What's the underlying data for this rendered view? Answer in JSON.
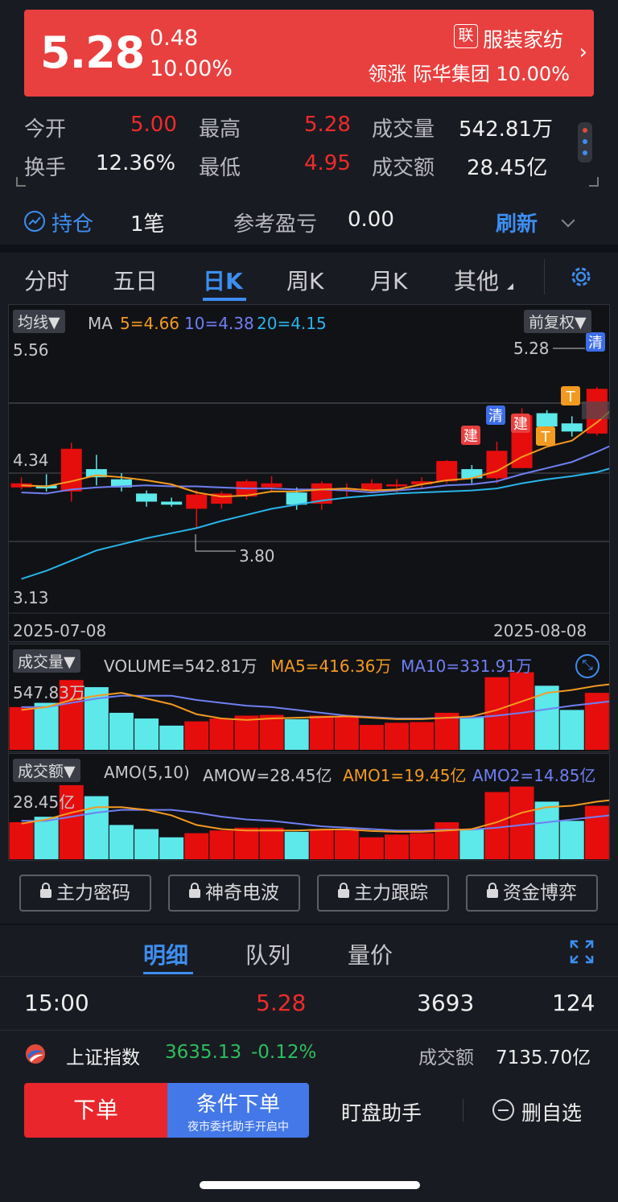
{
  "header": {
    "price": "5.28",
    "change": "0.48",
    "change_pct": "10.00%",
    "sector_tag": "联",
    "sector_name": "服装家纺",
    "leader_label": "领涨",
    "leader_name": "际华集团",
    "leader_pct": "10.00%",
    "colors": {
      "up": "#e8403f"
    }
  },
  "stats": [
    {
      "label": "今开",
      "value": "5.00"
    },
    {
      "label": "最高",
      "value": "5.28"
    },
    {
      "label": "成交量",
      "value": "542.81万"
    },
    {
      "label": "换手",
      "value": "12.36%"
    },
    {
      "label": "最低",
      "value": "4.95"
    },
    {
      "label": "成交额",
      "value": "28.45亿"
    }
  ],
  "position": {
    "label": "持仓",
    "count": "1笔",
    "pl_label": "参考盈亏",
    "pl_value": "0.00",
    "refresh": "刷新"
  },
  "tabs": [
    "分时",
    "五日",
    "日K",
    "周K",
    "月K",
    "其他"
  ],
  "active_tab": "日K",
  "kchart": {
    "ma_dropdown": "均线▼",
    "ma_label": "MA",
    "ma5": "5=4.66",
    "ma10": "10=4.38",
    "ma20": "20=4.15",
    "adjust": "前复权▼",
    "y_top": "5.56",
    "y_mid": "4.34",
    "y_bot": "3.13",
    "high_mark": "5.28",
    "low_mark": "3.80",
    "date_start": "2025-07-08",
    "date_end": "2025-08-08",
    "markers": [
      "建",
      "清",
      "建",
      "T",
      "T",
      "清"
    ]
  },
  "volume": {
    "dropdown": "成交量▼",
    "volume_label": "VOLUME=542.81万",
    "ma5_label": "MA5=416.36万",
    "ma10_label": "MA10=331.91万",
    "max_label": "547.83万"
  },
  "amount": {
    "dropdown": "成交额▼",
    "amo_label": "AMO(5,10)",
    "amow_label": "AMOW=28.45亿",
    "amo1_label": "AMO1=19.45亿",
    "amo2_label": "AMO2=14.85亿",
    "max_label": "28.45亿"
  },
  "chart_data": {
    "type": "candlestick",
    "x_start": "2025-07-08",
    "x_end": "2025-08-08",
    "ylim": [
      3.13,
      5.56
    ],
    "ohlc": [
      [
        4.2,
        4.3,
        4.18,
        4.24
      ],
      [
        4.22,
        4.33,
        4.16,
        4.19
      ],
      [
        4.16,
        4.64,
        4.06,
        4.58
      ],
      [
        4.38,
        4.52,
        4.22,
        4.3
      ],
      [
        4.28,
        4.34,
        4.16,
        4.2
      ],
      [
        4.14,
        4.17,
        4.01,
        4.06
      ],
      [
        4.06,
        4.1,
        4.01,
        4.03
      ],
      [
        3.99,
        4.17,
        3.8,
        4.13
      ],
      [
        4.04,
        4.16,
        3.99,
        4.14
      ],
      [
        4.11,
        4.28,
        4.08,
        4.26
      ],
      [
        4.2,
        4.31,
        4.15,
        4.24
      ],
      [
        4.15,
        4.2,
        3.98,
        4.03
      ],
      [
        4.04,
        4.26,
        3.98,
        4.24
      ],
      [
        4.18,
        4.24,
        4.11,
        4.18
      ],
      [
        4.18,
        4.28,
        4.15,
        4.24
      ],
      [
        4.21,
        4.28,
        4.15,
        4.23
      ],
      [
        4.23,
        4.3,
        4.18,
        4.26
      ],
      [
        4.26,
        4.47,
        4.24,
        4.46
      ],
      [
        4.38,
        4.42,
        4.24,
        4.29
      ],
      [
        4.29,
        4.65,
        4.24,
        4.56
      ],
      [
        4.39,
        4.98,
        4.39,
        4.91
      ],
      [
        4.93,
        4.96,
        4.74,
        4.8
      ],
      [
        4.83,
        4.9,
        4.7,
        4.75
      ],
      [
        4.73,
        5.19,
        4.71,
        5.17
      ],
      [
        5.0,
        5.28,
        4.95,
        5.28
      ]
    ],
    "ma5": [
      4.22,
      4.21,
      4.26,
      4.32,
      4.3,
      4.27,
      4.23,
      4.15,
      4.11,
      4.12,
      4.16,
      4.16,
      4.18,
      4.19,
      4.17,
      4.18,
      4.23,
      4.27,
      4.29,
      4.36,
      4.5,
      4.6,
      4.66,
      4.84,
      5.05
    ],
    "ma10": [
      4.15,
      4.14,
      4.18,
      4.2,
      4.21,
      4.22,
      4.21,
      4.21,
      4.2,
      4.19,
      4.19,
      4.18,
      4.18,
      4.17,
      4.15,
      4.17,
      4.19,
      4.22,
      4.23,
      4.26,
      4.33,
      4.39,
      4.45,
      4.55,
      4.66
    ],
    "ma20": [
      3.3,
      3.38,
      3.48,
      3.58,
      3.64,
      3.7,
      3.75,
      3.8,
      3.87,
      3.93,
      3.99,
      4.03,
      4.07,
      4.1,
      4.12,
      4.14,
      4.15,
      4.16,
      4.17,
      4.19,
      4.24,
      4.28,
      4.31,
      4.35,
      4.42
    ],
    "volume": [
      300,
      330,
      490,
      440,
      260,
      220,
      170,
      200,
      220,
      240,
      245,
      215,
      240,
      230,
      175,
      190,
      195,
      260,
      230,
      510,
      545,
      450,
      280,
      400,
      547.83
    ],
    "volume_ma5": [
      280,
      300,
      350,
      380,
      400,
      360,
      320,
      250,
      220,
      210,
      220,
      225,
      230,
      235,
      225,
      215,
      215,
      225,
      235,
      280,
      340,
      400,
      420,
      450,
      470
    ],
    "volume_ma10": [
      300,
      300,
      330,
      360,
      380,
      380,
      380,
      350,
      330,
      310,
      300,
      280,
      260,
      240,
      230,
      220,
      220,
      225,
      225,
      240,
      260,
      285,
      310,
      330,
      350
    ],
    "amount": [
      13.5,
      15.5,
      27.0,
      23.0,
      12.5,
      11.0,
      8.0,
      9.5,
      10.5,
      11.5,
      11.5,
      10.0,
      11.0,
      10.5,
      8.0,
      9.0,
      9.5,
      13.5,
      11.0,
      24.5,
      26.5,
      21.0,
      14.0,
      19.5,
      28.45
    ],
    "amount_ma5": [
      13,
      14.5,
      17,
      19,
      19,
      18,
      16,
      12.5,
      11,
      10.5,
      10.5,
      10.5,
      10.8,
      10.9,
      10.3,
      10.0,
      10.0,
      10.5,
      11.0,
      13.5,
      17,
      19,
      19.5,
      21,
      22
    ],
    "amount_ma10": [
      14,
      14,
      15.5,
      17,
      18,
      18,
      18,
      17,
      15.5,
      14.5,
      14,
      13,
      12,
      11.5,
      11,
      10.5,
      10.5,
      10.8,
      10.8,
      11.5,
      12.5,
      13.5,
      14.5,
      15.5,
      16.5
    ]
  },
  "feature_buttons": [
    "主力密码",
    "神奇电波",
    "主力跟踪",
    "资金博弈"
  ],
  "detail_tabs": [
    "明细",
    "队列",
    "量价"
  ],
  "trade": {
    "time": "15:00",
    "price": "5.28",
    "volume": "3693",
    "count": "124"
  },
  "index": {
    "name": "上证指数",
    "value": "3635.13",
    "change": "-0.12%",
    "amount_label": "成交额",
    "amount": "7135.70亿"
  },
  "bottom": {
    "order": "下单",
    "cond_order": "条件下单",
    "cond_sub": "夜市委托助手开启中",
    "assistant": "盯盘助手",
    "remove": "删自选"
  }
}
